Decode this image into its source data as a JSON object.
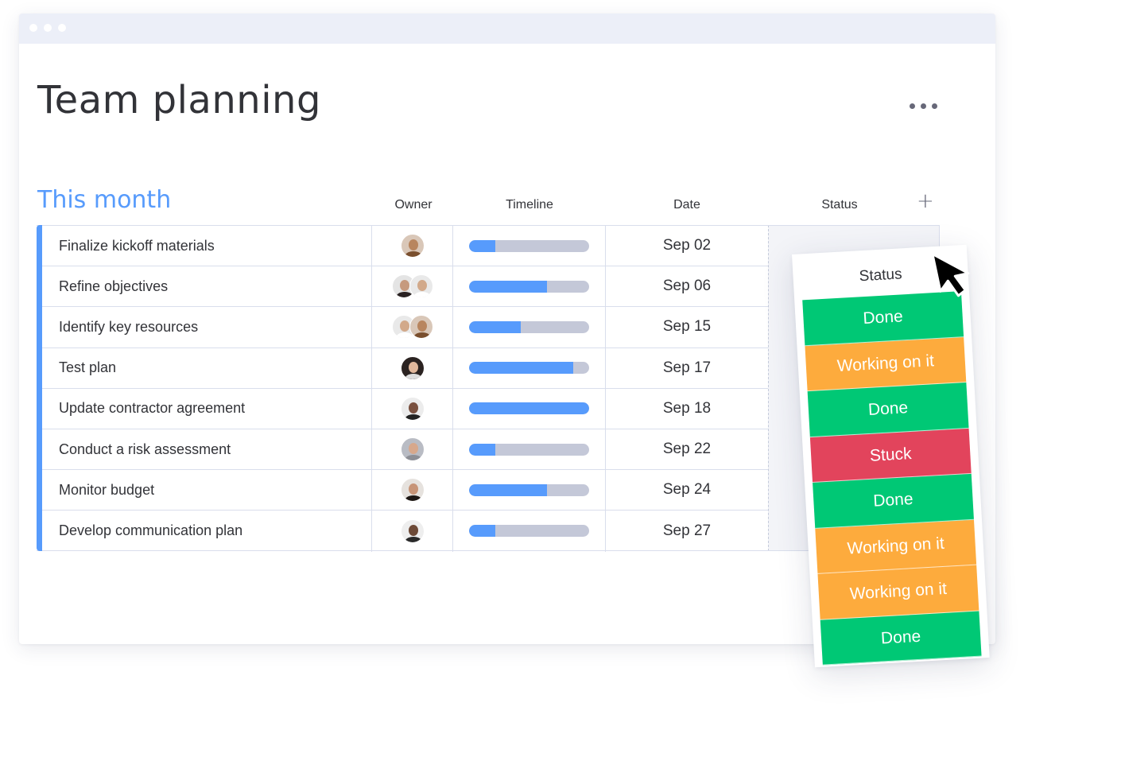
{
  "window": {
    "title": "Team planning",
    "more_menu_icon": "more-horizontal-icon"
  },
  "group": {
    "title": "This month",
    "color": "#579bfc",
    "columns": {
      "owner": "Owner",
      "timeline": "Timeline",
      "date": "Date",
      "status": "Status",
      "add_column": "+"
    },
    "rows": [
      {
        "name": "Finalize kickoff materials",
        "owners": [
          "woman-long-hair"
        ],
        "timeline_progress": 0.22,
        "date": "Sep 02"
      },
      {
        "name": "Refine objectives",
        "owners": [
          "woman-dark-hair",
          "man-short-hair"
        ],
        "timeline_progress": 0.65,
        "date": "Sep 06"
      },
      {
        "name": "Identify key resources",
        "owners": [
          "man-short-hair",
          "woman-long-hair"
        ],
        "timeline_progress": 0.43,
        "date": "Sep 15"
      },
      {
        "name": "Test plan",
        "owners": [
          "woman-dark-background"
        ],
        "timeline_progress": 0.87,
        "date": "Sep 17"
      },
      {
        "name": "Update contractor agreement",
        "owners": [
          "man-beard"
        ],
        "timeline_progress": 1.0,
        "date": "Sep 18"
      },
      {
        "name": "Conduct a risk assessment",
        "owners": [
          "man-bald-beard"
        ],
        "timeline_progress": 0.22,
        "date": "Sep 22"
      },
      {
        "name": "Monitor budget",
        "owners": [
          "woman-curly-hair"
        ],
        "timeline_progress": 0.65,
        "date": "Sep 24"
      },
      {
        "name": "Develop communication plan",
        "owners": [
          "man-smiling"
        ],
        "timeline_progress": 0.22,
        "date": "Sep 27"
      }
    ]
  },
  "status_panel": {
    "header": "Status",
    "items": [
      {
        "label": "Done",
        "color": "#00c875"
      },
      {
        "label": "Working on it",
        "color": "#fdab3d"
      },
      {
        "label": "Done",
        "color": "#00c875"
      },
      {
        "label": "Stuck",
        "color": "#e2445c"
      },
      {
        "label": "Done",
        "color": "#00c875"
      },
      {
        "label": "Working on it",
        "color": "#fdab3d"
      },
      {
        "label": "Working on it",
        "color": "#fdab3d"
      },
      {
        "label": "Done",
        "color": "#00c875"
      }
    ]
  },
  "cursor": {
    "icon": "mouse-pointer-icon"
  }
}
